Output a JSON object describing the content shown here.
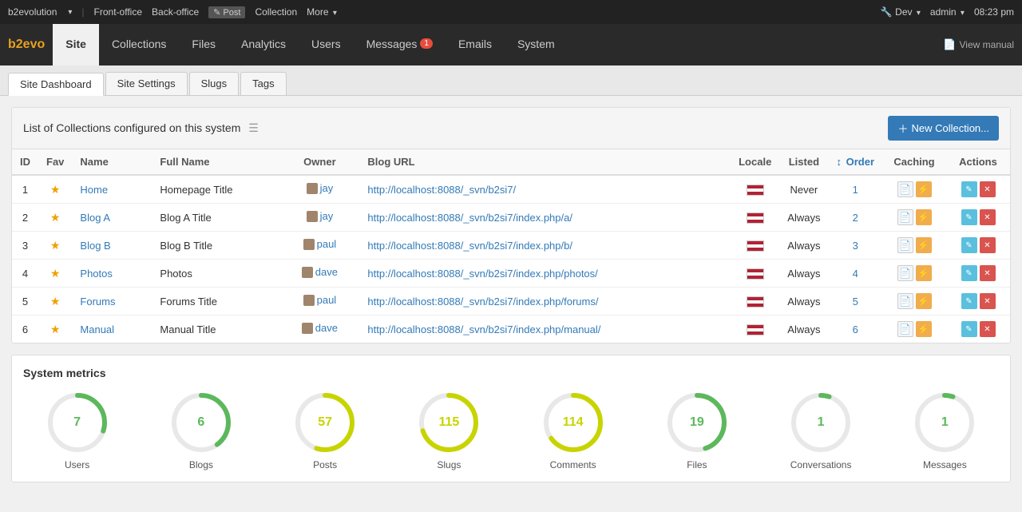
{
  "topbar": {
    "brand": "b2evolution",
    "links": [
      "Front-office",
      "Back-office",
      "Post",
      "Collection",
      "More"
    ],
    "right": {
      "dev": "Dev",
      "admin": "admin",
      "time": "08:23 pm"
    }
  },
  "mainnav": {
    "brand": "b2evo",
    "tabs": [
      {
        "id": "site",
        "label": "Site",
        "active": true,
        "badge": null
      },
      {
        "id": "collections",
        "label": "Collections",
        "active": false,
        "badge": null
      },
      {
        "id": "files",
        "label": "Files",
        "active": false,
        "badge": null
      },
      {
        "id": "analytics",
        "label": "Analytics",
        "active": false,
        "badge": null
      },
      {
        "id": "users",
        "label": "Users",
        "active": false,
        "badge": null
      },
      {
        "id": "messages",
        "label": "Messages",
        "active": false,
        "badge": "1"
      },
      {
        "id": "emails",
        "label": "Emails",
        "active": false,
        "badge": null
      },
      {
        "id": "system",
        "label": "System",
        "active": false,
        "badge": null
      }
    ],
    "viewmanual": "View manual"
  },
  "subtabs": [
    {
      "id": "dashboard",
      "label": "Site Dashboard",
      "active": true
    },
    {
      "id": "settings",
      "label": "Site Settings",
      "active": false
    },
    {
      "id": "slugs",
      "label": "Slugs",
      "active": false
    },
    {
      "id": "tags",
      "label": "Tags",
      "active": false
    }
  ],
  "collections": {
    "panel_title": "List of Collections configured on this system",
    "new_button": "New Collection...",
    "columns": {
      "id": "ID",
      "fav": "Fav",
      "name": "Name",
      "fullname": "Full Name",
      "owner": "Owner",
      "url": "Blog URL",
      "locale": "Locale",
      "listed": "Listed",
      "order": "Order",
      "caching": "Caching",
      "actions": "Actions"
    },
    "rows": [
      {
        "id": 1,
        "fav": true,
        "name": "Home",
        "fullname": "Homepage Title",
        "owner": "jay",
        "url": "http://localhost:8088/_svn/b2si7/",
        "listed": "Never",
        "order": 1
      },
      {
        "id": 2,
        "fav": true,
        "name": "Blog A",
        "fullname": "Blog A Title",
        "owner": "jay",
        "url": "http://localhost:8088/_svn/b2si7/index.php/a/",
        "listed": "Always",
        "order": 2
      },
      {
        "id": 3,
        "fav": true,
        "name": "Blog B",
        "fullname": "Blog B Title",
        "owner": "paul",
        "url": "http://localhost:8088/_svn/b2si7/index.php/b/",
        "listed": "Always",
        "order": 3
      },
      {
        "id": 4,
        "fav": true,
        "name": "Photos",
        "fullname": "Photos",
        "owner": "dave",
        "url": "http://localhost:8088/_svn/b2si7/index.php/photos/",
        "listed": "Always",
        "order": 4
      },
      {
        "id": 5,
        "fav": true,
        "name": "Forums",
        "fullname": "Forums Title",
        "owner": "paul",
        "url": "http://localhost:8088/_svn/b2si7/index.php/forums/",
        "listed": "Always",
        "order": 5
      },
      {
        "id": 6,
        "fav": true,
        "name": "Manual",
        "fullname": "Manual Title",
        "owner": "dave",
        "url": "http://localhost:8088/_svn/b2si7/index.php/manual/",
        "listed": "Always",
        "order": 6
      }
    ]
  },
  "metrics": {
    "title": "System metrics",
    "items": [
      {
        "label": "Users",
        "value": 7,
        "color": "#5cb85c",
        "percent": 30
      },
      {
        "label": "Blogs",
        "value": 6,
        "color": "#5cb85c",
        "percent": 40
      },
      {
        "label": "Posts",
        "value": 57,
        "color": "#c8d400",
        "percent": 55
      },
      {
        "label": "Slugs",
        "value": 115,
        "color": "#c8d400",
        "percent": 70
      },
      {
        "label": "Comments",
        "value": 114,
        "color": "#c8d400",
        "percent": 65
      },
      {
        "label": "Files",
        "value": 19,
        "color": "#5cb85c",
        "percent": 45
      },
      {
        "label": "Conversations",
        "value": 1,
        "color": "#5cb85c",
        "percent": 5
      },
      {
        "label": "Messages",
        "value": 1,
        "color": "#5cb85c",
        "percent": 5
      }
    ]
  }
}
